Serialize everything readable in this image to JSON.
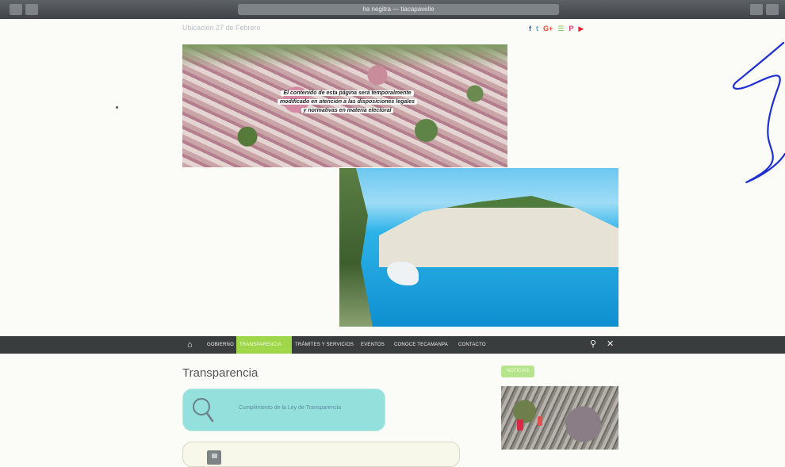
{
  "browser": {
    "url_text": "ha negitra — tiacapavelle"
  },
  "header": {
    "topline": "Ubicación 27 de Febrero",
    "social_icons": [
      {
        "name": "facebook-icon",
        "glyph": "f",
        "color": "#3b5998"
      },
      {
        "name": "twitter-icon",
        "glyph": "t",
        "color": "#55acee"
      },
      {
        "name": "googleplus-icon",
        "glyph": "G+",
        "color": "#dd4b39"
      },
      {
        "name": "rss-icon",
        "glyph": "☰",
        "color": "#7fbf3f"
      },
      {
        "name": "pinterest-icon",
        "glyph": "P",
        "color": "#e33b6c"
      },
      {
        "name": "youtube-icon",
        "glyph": "▶",
        "color": "#e5202f"
      }
    ]
  },
  "hero": {
    "notice_lines": [
      "El contenido de esta página será temporalmente",
      "modificado en atención a las disposiciones legales",
      "y normativas en materia electoral"
    ]
  },
  "nav": {
    "items": [
      {
        "label": "GOBIERNO",
        "active": false
      },
      {
        "label": "TRANSPARENCIA",
        "active": true
      },
      {
        "label": "TRÁMITES Y SERVICIOS",
        "active": false
      },
      {
        "label": "EVENTOS",
        "active": false
      },
      {
        "label": "CONOCE TECAMANPA",
        "active": false
      },
      {
        "label": "CONTACTO",
        "active": false
      }
    ]
  },
  "main": {
    "title": "Transparencia",
    "card_label": "Cumplimiento de la Ley de Transparencia"
  },
  "sidebar": {
    "tag": "NOTICIAS"
  }
}
